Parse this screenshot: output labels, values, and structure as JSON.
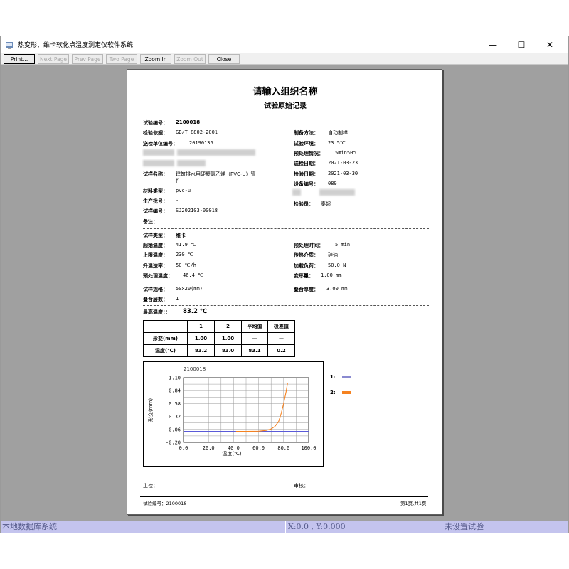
{
  "window": {
    "title": "热变形、维卡软化点温度测定仪软件系统",
    "minimize": "—",
    "maximize": "☐",
    "close": "✕"
  },
  "toolbar": {
    "print": "Print...",
    "next_page": "Next Page",
    "prev_page": "Prev Page",
    "two_page": "Two Page",
    "zoom_in": "Zoom In",
    "zoom_out": "Zoom Out",
    "close": "Close"
  },
  "report": {
    "org_title": "请输入组织名称",
    "subtitle": "试验原始记录",
    "left_fields": [
      {
        "label": "试验编号：",
        "value": "2100018"
      },
      {
        "label": "检验依据：",
        "value": "GB/T 8802-2001"
      },
      {
        "label": "送检单位编号：",
        "value": "20190136"
      },
      {
        "label": "",
        "value": ""
      },
      {
        "label": "",
        "value": ""
      },
      {
        "label": "试样名称：",
        "value": "建筑排水用硬聚氯乙烯（PVC-U）管",
        "value2": "件"
      },
      {
        "label": "材料类型：",
        "value": "pvc-u"
      },
      {
        "label": "生产批号：",
        "value": "-"
      },
      {
        "label": "试样编号：",
        "value": "SJ202103-00018"
      },
      {
        "label": "备注：",
        "value": ""
      }
    ],
    "right_fields": [
      {
        "label": "制备方法：",
        "value": "自动制样"
      },
      {
        "label": "试验环境：",
        "value": "23.5℃"
      },
      {
        "label": "预处理情况：",
        "value": "5min50℃"
      },
      {
        "label": "送检日期：",
        "value": "2021-03-23"
      },
      {
        "label": "检验日期：",
        "value": "2021-03-30"
      },
      {
        "label": "设备编号：",
        "value": "089"
      },
      {
        "label": "",
        "value": ""
      },
      {
        "label": "检验员：",
        "value": "秦超"
      }
    ],
    "params_left": [
      {
        "label": "试样类型：",
        "value": "维卡"
      },
      {
        "label": "起始温度：",
        "value": "41.9 ℃"
      },
      {
        "label": "上限温度：",
        "value": "230 ℃"
      },
      {
        "label": "升温速率：",
        "value": "50 ℃/h"
      },
      {
        "label": "预处理温度：",
        "value": "46.4 ℃"
      }
    ],
    "params_right": [
      {
        "label": "预处理时间：",
        "value": "5 min"
      },
      {
        "label": "传热介质：",
        "value": "硅油"
      },
      {
        "label": "加载负荷：",
        "value": "50.0 N"
      },
      {
        "label": "变形量：",
        "value": "1.00 mm"
      }
    ],
    "spec": {
      "label": "试样规格：",
      "value": "50x20(mm)"
    },
    "stack_count": {
      "label": "叠合层数：",
      "value": "1"
    },
    "stack_thickness": {
      "label": "叠合厚度：",
      "value": "3.00 mm"
    },
    "max_temp": {
      "label": "最高温度：：",
      "value": "83.2 ℃"
    },
    "table": {
      "headers": [
        "",
        "1",
        "2",
        "平均值",
        "极差值"
      ],
      "rows": [
        [
          "形变(mm)",
          "1.00",
          "1.00",
          "—",
          "—"
        ],
        [
          "温度(℃)",
          "83.2",
          "83.0",
          "83.1",
          "0.2"
        ]
      ]
    },
    "legend": [
      {
        "label": "1:",
        "color": "#8a8ad0"
      },
      {
        "label": "2:",
        "color": "#f58220"
      }
    ],
    "signatures": {
      "chief": "主检：",
      "chief_line": "______________",
      "reviewer": "审核：",
      "reviewer_line": "______________"
    },
    "footer": {
      "left": "试验编号：2100018",
      "right": "第1页,共1页"
    }
  },
  "chart_data": {
    "type": "line",
    "title": "2100018",
    "xlabel": "温度(℃)",
    "ylabel": "形变(mm)",
    "xlim": [
      0,
      100
    ],
    "ylim": [
      -0.2,
      1.1
    ],
    "xticks": [
      "0.0",
      "20.0",
      "40.0",
      "60.0",
      "80.0",
      "100.0"
    ],
    "yticks": [
      "1.10",
      "0.84",
      "0.58",
      "0.32",
      "0.06",
      "-0.20"
    ],
    "grid": true,
    "series": [
      {
        "name": "1",
        "color": "#5a5ad8",
        "x": [
          0,
          100
        ],
        "y": [
          0.02,
          0.02
        ]
      },
      {
        "name": "2",
        "color": "#f58220",
        "x": [
          42,
          50,
          60,
          66,
          70,
          73,
          76,
          78,
          80,
          82,
          83.2
        ],
        "y": [
          0.02,
          0.02,
          0.025,
          0.04,
          0.07,
          0.12,
          0.22,
          0.38,
          0.58,
          0.82,
          1.0
        ]
      }
    ]
  },
  "status": {
    "left": "本地数据库系统",
    "middle": "X:0.0 , Y:0.000",
    "right": "未设置试验"
  }
}
